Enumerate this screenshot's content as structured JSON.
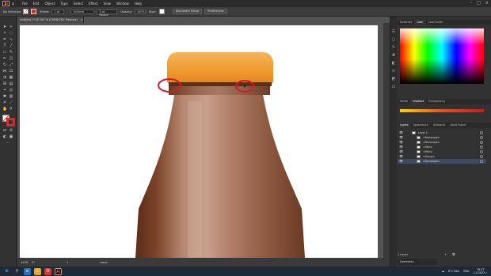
{
  "menubar": {
    "logo": "Ai",
    "items": [
      "File",
      "Edit",
      "Object",
      "Type",
      "Select",
      "Effect",
      "View",
      "Window",
      "Help"
    ]
  },
  "controlbar": {
    "selection_label": "No Selection",
    "stroke_label": "Stroke:",
    "stroke_value": "1 pt",
    "uniform_label": "Uniform",
    "brush_label": "5 pt. Round",
    "opacity_label": "Opacity:",
    "opacity_value": "100%",
    "style_label": "Style:",
    "doc_setup_label": "Document Setup",
    "preferences_label": "Preferences"
  },
  "document": {
    "tab_title": "Untitled-1* @ 100 % (CMYK/CPU Preview)",
    "tab_close": "×",
    "zoom": "100%",
    "rotation": "0°",
    "artboard_nav": "1",
    "status_label": "Hand"
  },
  "panels": {
    "color_tabs": [
      "Swatches",
      "Color",
      "Color Guide"
    ],
    "gradient_tabs": [
      "Stroke",
      "Gradient",
      "Transparency"
    ],
    "layers_tabs": [
      "Layers",
      "Appearance",
      "Artboards",
      "Asset Export"
    ],
    "layers": [
      {
        "name": "Layer 1",
        "selected": false
      },
      {
        "name": "<Rectangle>",
        "selected": false
      },
      {
        "name": "<Rectangle>",
        "selected": false
      },
      {
        "name": "<Path>",
        "selected": false
      },
      {
        "name": "<Path>",
        "selected": false
      },
      {
        "name": "<Group>",
        "selected": false
      },
      {
        "name": "<Rectangle>",
        "selected": true
      }
    ],
    "layers_count": "1 Layer",
    "comments_label": "Comments"
  },
  "taskbar": {
    "weather": "8°C Rain",
    "lang": "ENG",
    "time": "19:57",
    "date": "1.4.2023 г."
  },
  "colors": {
    "accent": "#ff9a00",
    "selection": "#3d4a66",
    "highlight_circle": "#d01c2a",
    "bottle_dark": "#6b3a24",
    "cap": "#f2a035"
  }
}
